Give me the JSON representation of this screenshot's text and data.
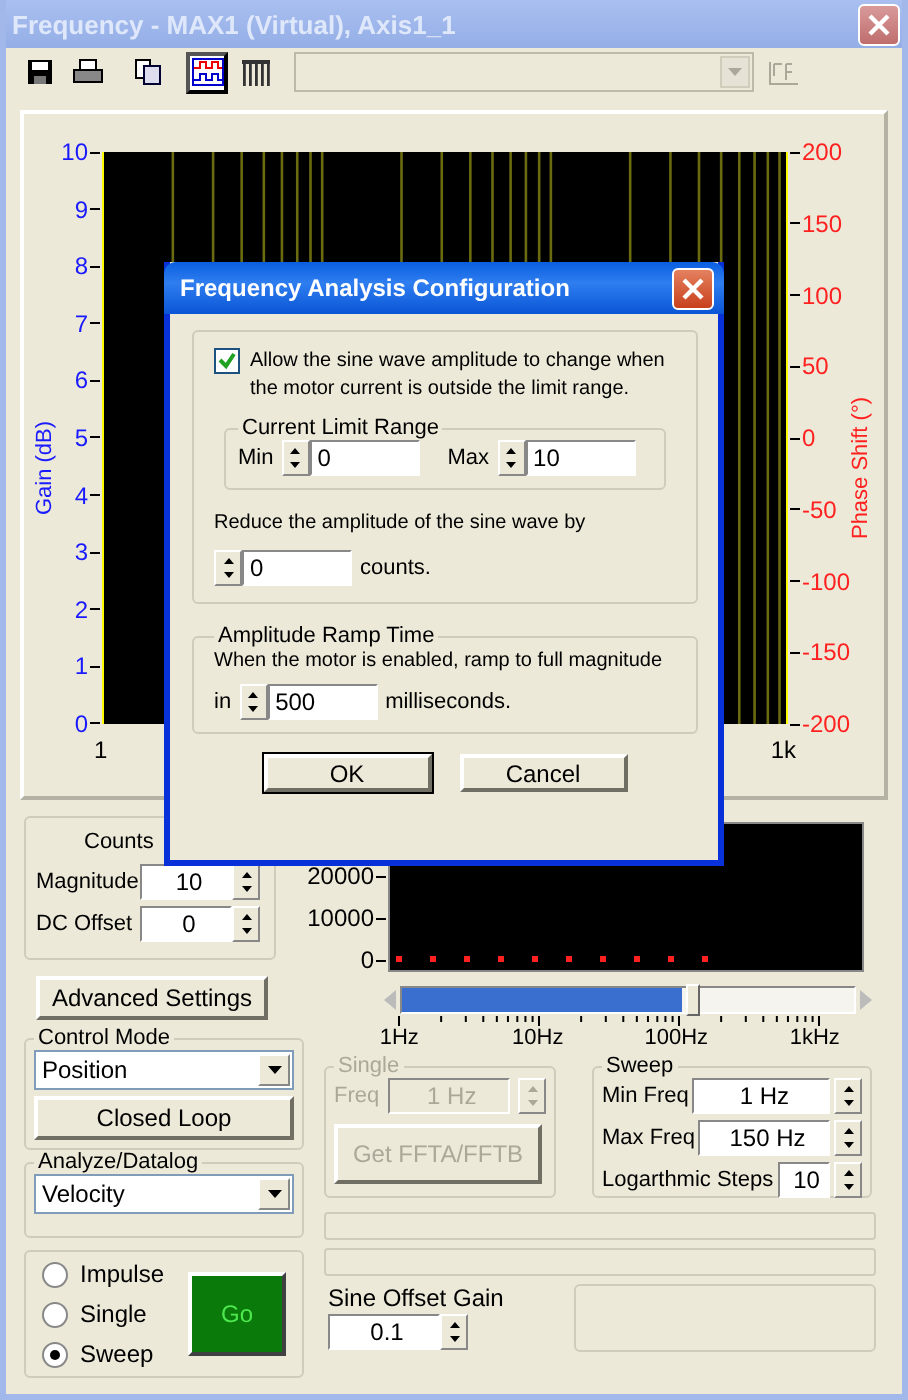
{
  "window": {
    "title": "Frequency - MAX1 (Virtual), Axis1_1"
  },
  "toolbar": {
    "tools": [
      {
        "kind": "save",
        "selected": false
      },
      {
        "kind": "print",
        "selected": false
      },
      {
        "kind": "copy",
        "selected": false
      },
      {
        "kind": "chart",
        "selected": true
      },
      {
        "kind": "grid",
        "selected": false
      }
    ],
    "combo_disabled": true
  },
  "gain_chart": {
    "gain_title": "Gain (dB)",
    "phase_title": "Phase Shift (°)",
    "gain_ticks": [
      "10",
      "9",
      "8",
      "7",
      "6",
      "5",
      "4",
      "3",
      "2",
      "1",
      "0"
    ],
    "phase_ticks": [
      "200",
      "150",
      "100",
      "50",
      "0",
      "-50",
      "-100",
      "-150",
      "-200"
    ],
    "x_ticks": [
      "1",
      "1k"
    ]
  },
  "counts": {
    "title": "Counts",
    "fields": [
      {
        "label": "Magnitude",
        "value": "10"
      },
      {
        "label": "DC Offset",
        "value": "0"
      }
    ]
  },
  "spectrum": {
    "y_ticks": [
      "20000",
      "10000",
      "0"
    ],
    "slider": {
      "level": 0.62
    },
    "x_ticks": [
      "1Hz",
      "10Hz",
      "100Hz",
      "1kHz"
    ]
  },
  "advanced_button": "Advanced Settings",
  "control_mode": {
    "title": "Control Mode",
    "value": "Position",
    "button": "Closed Loop"
  },
  "analyze": {
    "title": "Analyze/Datalog",
    "value": "Velocity"
  },
  "modes": [
    {
      "label": "Impulse",
      "selected": false
    },
    {
      "label": "Single",
      "selected": false
    },
    {
      "label": "Sweep",
      "selected": true
    }
  ],
  "go_button": "Go",
  "single": {
    "title": "Single",
    "disabled": true,
    "freq_label": "Freq",
    "freq_value": "1 Hz",
    "button": "Get FFTA/FFTB"
  },
  "sweep": {
    "title": "Sweep",
    "fields": [
      {
        "label": "Min Freq",
        "value": "1 Hz"
      },
      {
        "label": "Max Freq",
        "value": "150 Hz"
      },
      {
        "label": "Logarthmic Steps",
        "value": "10"
      }
    ]
  },
  "progress_bars": [
    {
      "level": 0
    },
    {
      "level": 0
    }
  ],
  "sine_offset_gain": {
    "label": "Sine Offset Gain",
    "value": "0.1"
  },
  "dialog": {
    "title": "Frequency Analysis Configuration",
    "allow_checkbox": {
      "label": "Allow the sine wave amplitude to change when the motor current is outside the limit range.",
      "checked": true
    },
    "current_limit": {
      "title": "Current Limit Range",
      "min_label": "Min",
      "min_value": "0",
      "max_label": "Max",
      "max_value": "10"
    },
    "reduce": {
      "text": "Reduce the amplitude of the sine wave by",
      "value": "0",
      "unit": "counts."
    },
    "ramp": {
      "title": "Amplitude Ramp Time",
      "text": "When the motor is enabled, ramp to full magnitude",
      "prefix": "in",
      "value": "500",
      "unit": "milliseconds."
    },
    "buttons": [
      {
        "label": "OK",
        "default": true
      },
      {
        "label": "Cancel",
        "default": false
      }
    ]
  }
}
